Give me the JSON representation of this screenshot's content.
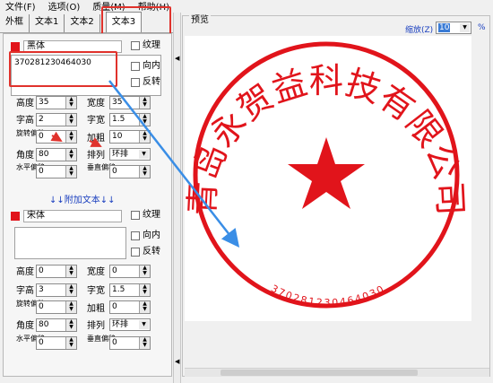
{
  "menu": [
    "文件(F)",
    "选项(O)",
    "质量(M)",
    "帮助(H)"
  ],
  "tabs": {
    "t1": "外框",
    "t2": "文本1",
    "t3": "文本2",
    "t4": "文本3"
  },
  "block1": {
    "font": "黑体",
    "text": "370281230464030",
    "opt_texture": "纹理",
    "opt_inward": "向内",
    "opt_reverse": "反转",
    "rows": {
      "height_label": "高度",
      "height": "35",
      "width_label": "宽度",
      "width": "35",
      "char_h_label": "字高",
      "char_h": "2",
      "char_w_label": "字宽",
      "char_w": "1.5",
      "rot_label": "旋转偏移",
      "rot": "0",
      "bold_label": "加粗",
      "bold": "10",
      "angle_label": "角度",
      "angle": "80",
      "arrange_label": "排列",
      "arrange": "环排",
      "hoff_label": "水平偏移",
      "hoff": "0",
      "voff_label": "垂直偏移",
      "voff": "0"
    }
  },
  "add_text": "↓↓附加文本↓↓",
  "block2": {
    "font": "宋体",
    "text": "",
    "opt_texture": "纹理",
    "opt_inward": "向内",
    "opt_reverse": "反转",
    "rows": {
      "height_label": "高度",
      "height": "0",
      "width_label": "宽度",
      "width": "0",
      "char_h_label": "字高",
      "char_h": "3",
      "char_w_label": "字宽",
      "char_w": "1.5",
      "rot_label": "旋转偏移",
      "rot": "0",
      "bold_label": "加粗",
      "bold": "0",
      "angle_label": "角度",
      "angle": "80",
      "arrange_label": "排列",
      "arrange": "环排",
      "hoff_label": "水平偏移",
      "hoff": "0",
      "voff_label": "垂直偏移",
      "voff": "0"
    }
  },
  "preview": {
    "title": "预览",
    "zoom_label": "缩放(Z)",
    "zoom_value": "10",
    "pct": "%"
  },
  "stamp": {
    "company": "青岛永贺益科技有限公司",
    "code": "370281230464030",
    "color": "#e1141b"
  },
  "colors": {
    "annotation_red": "#e0322c",
    "arrow_blue": "#3a8ee6"
  }
}
